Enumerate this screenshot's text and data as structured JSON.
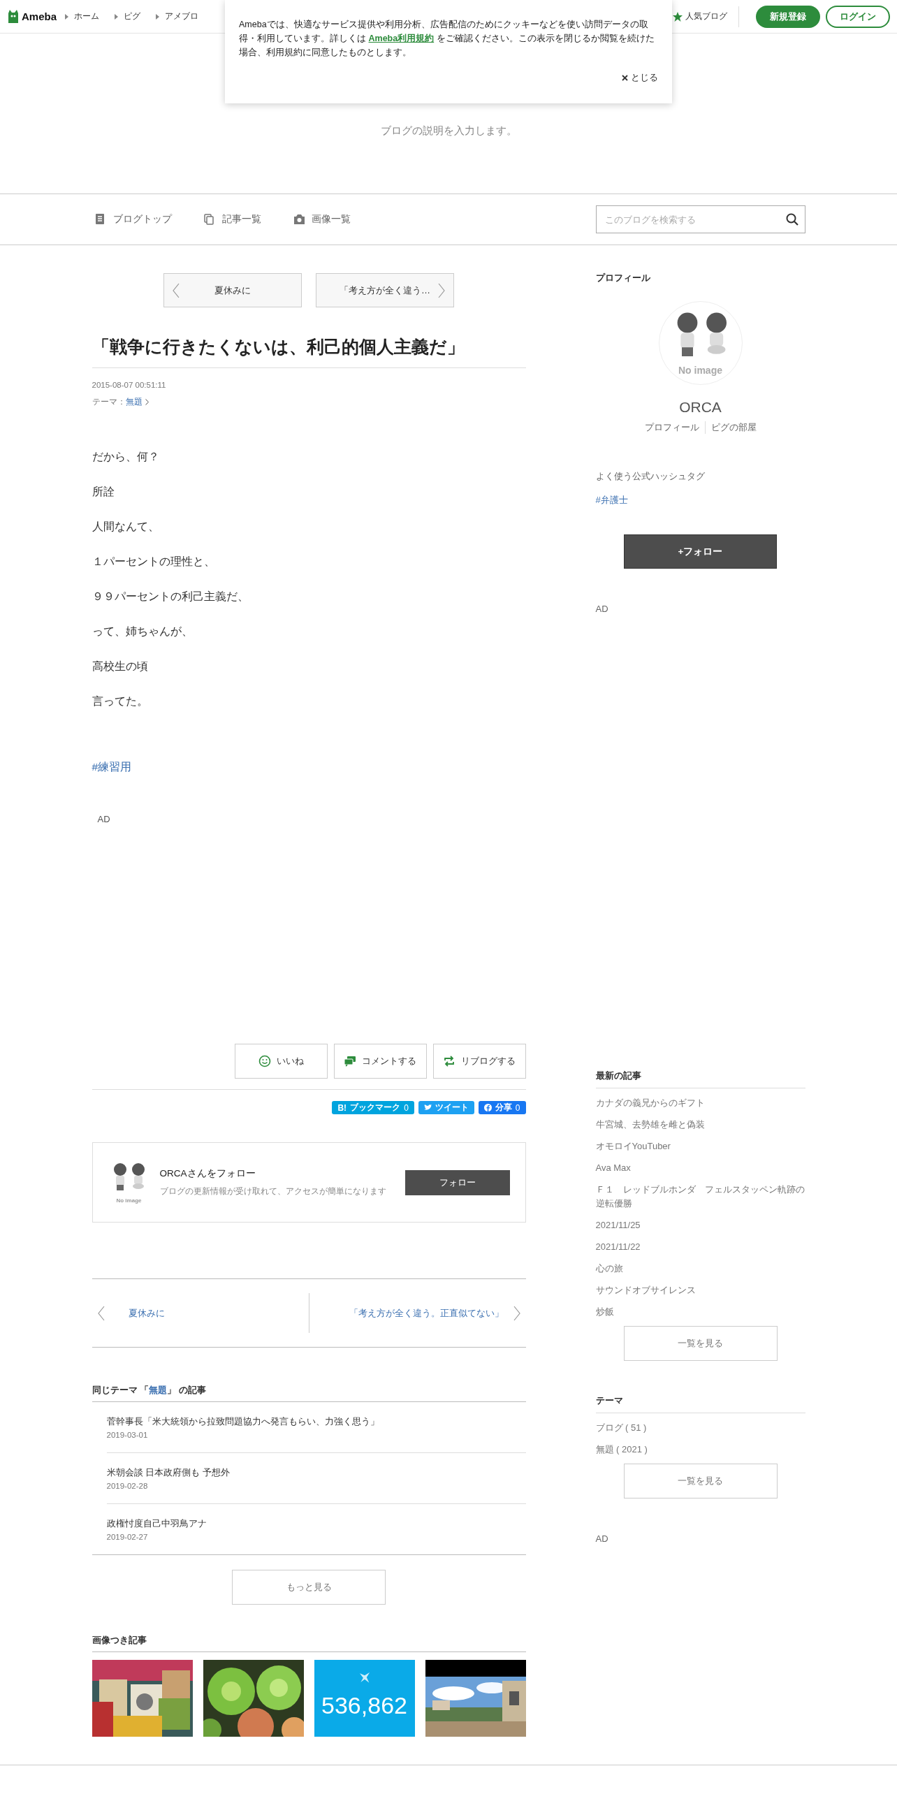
{
  "header": {
    "logo": "Ameba",
    "nav": [
      "ホーム",
      "ピグ",
      "アメブロ"
    ],
    "popular": "人気ブログ",
    "signup": "新規登録",
    "login": "ログイン"
  },
  "cookie_notice": {
    "text_before": "Amebaでは、快適なサービス提供や利用分析、広告配信のためにクッキーなどを使い訪問データの取得・利用しています。詳しくは ",
    "link": "Ameba利用規約",
    "text_after": " をご確認ください。この表示を閉じるか閲覧を続けた場合、利用規約に同意したものとします。",
    "close": "とじる"
  },
  "blog": {
    "description": "ブログの説明を入力します。"
  },
  "blog_nav": [
    {
      "label": "ブログトップ",
      "kind": "top"
    },
    {
      "label": "記事一覧",
      "kind": "list"
    },
    {
      "label": "画像一覧",
      "kind": "images"
    }
  ],
  "search": {
    "placeholder": "このブログを検索する"
  },
  "article": {
    "prev": "夏休みに",
    "next": "「考え方が全く違う…",
    "title": "「戦争に行きたくないは、利己的個人主義だ」",
    "date": "2015-08-07 00:51:11",
    "theme_label": "テーマ：",
    "theme": "無題",
    "body": [
      "だから、何？",
      "所詮",
      "人間なんて、",
      "１パーセントの理性と、",
      "９９パーセントの利己主義だ、",
      "って、姉ちゃんが、",
      "高校生の頃",
      "言ってた。"
    ],
    "hashtag": "#練習用",
    "ad": "AD"
  },
  "reactions": [
    {
      "label": "いいね",
      "kind": "like"
    },
    {
      "label": "コメントする",
      "kind": "comment"
    },
    {
      "label": "リブログする",
      "kind": "reblog"
    }
  ],
  "share": [
    {
      "kind": "hatena",
      "mark": "B!",
      "label": "ブックマーク",
      "count": "0"
    },
    {
      "kind": "twitter",
      "label": "ツイート"
    },
    {
      "kind": "facebook",
      "label": "分享",
      "count": "0"
    }
  ],
  "follow_card": {
    "avatar_label": "No image",
    "title": "ORCAさんをフォロー",
    "subtitle": "ブログの更新情報が受け取れて、アクセスが簡単になります",
    "button": "フォロー"
  },
  "pager": {
    "prev": "夏休みに",
    "next": "「考え方が全く違う。正直似てない」"
  },
  "same_theme": {
    "title_before": "同じテーマ 「",
    "theme": "無題",
    "title_after": "」 の記事",
    "items": [
      {
        "title": "菅幹事長「米大統領から拉致問題協力へ発言もらい、力強く思う」",
        "date": "2019-03-01"
      },
      {
        "title": "米朝会談 日本政府側も 予想外",
        "date": "2019-02-28"
      },
      {
        "title": "政権忖度自己中羽鳥アナ",
        "date": "2019-02-27"
      }
    ],
    "more": "もっと見る"
  },
  "image_articles": {
    "title": "画像つき記事",
    "items": [
      {
        "kind": "picture"
      },
      {
        "kind": "picture"
      },
      {
        "kind": "counter",
        "value": "536,862"
      },
      {
        "kind": "picture"
      }
    ]
  },
  "sidebar": {
    "profile_heading": "プロフィール",
    "avatar_label": "No image",
    "name": "ORCA",
    "links": [
      "プロフィール",
      "ピグの部屋"
    ],
    "hashtag_heading": "よく使う公式ハッシュタグ",
    "hashtags": [
      "#弁護士"
    ],
    "follow": "+フォロー",
    "ad": "AD",
    "recent": {
      "heading": "最新の記事",
      "items": [
        "カナダの義兄からのギフト",
        "牛宮城、去勢雄を雌と偽装",
        "オモロイYouTuber",
        "Ava Max",
        "Ｆ１　レッドブルホンダ　フェルスタッペン軌跡の逆転優勝",
        "2021/11/25",
        "2021/11/22",
        "心の旅",
        "サウンドオブサイレンス",
        "炒飯"
      ],
      "more": "一覧を見る"
    },
    "themes": {
      "heading": "テーマ",
      "items": [
        "ブログ ( 51 )",
        "無題 ( 2021 )"
      ],
      "more": "一覧を見る"
    },
    "ad2": "AD"
  }
}
